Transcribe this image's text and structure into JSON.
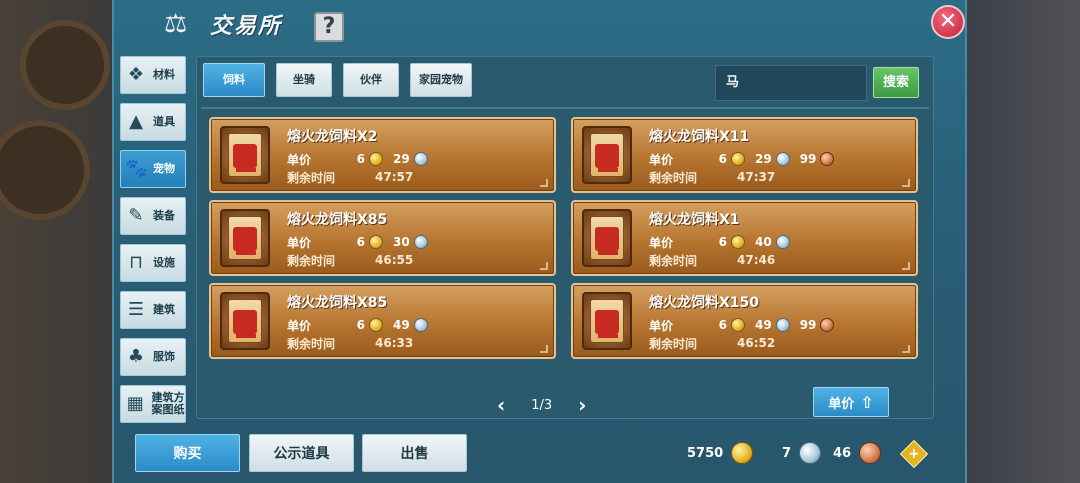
{
  "window": {
    "title": "交易所",
    "help_label": "?",
    "close_label": "✕"
  },
  "sidebar": {
    "items": [
      {
        "label": "材料",
        "icon": "materials-icon"
      },
      {
        "label": "道具",
        "icon": "item-icon"
      },
      {
        "label": "宠物",
        "icon": "paw-icon",
        "active": true
      },
      {
        "label": "装备",
        "icon": "equipment-icon"
      },
      {
        "label": "设施",
        "icon": "facility-icon"
      },
      {
        "label": "建筑",
        "icon": "building-icon"
      },
      {
        "label": "服饰",
        "icon": "clothing-icon"
      },
      {
        "label": "建筑方案图纸",
        "icon": "blueprint-icon"
      }
    ]
  },
  "tabs": [
    {
      "label": "饲料",
      "active": true
    },
    {
      "label": "坐骑"
    },
    {
      "label": "伙伴"
    },
    {
      "label": "家园宠物"
    }
  ],
  "search": {
    "value": "马",
    "button_label": "搜索"
  },
  "listings": [
    {
      "name": "熔火龙饲料X2",
      "price_label": "单价",
      "gold": "6",
      "silver": "29",
      "copper": "",
      "time_label": "剩余时间",
      "time": "47:57"
    },
    {
      "name": "熔火龙饲料X11",
      "price_label": "单价",
      "gold": "6",
      "silver": "29",
      "copper": "99",
      "time_label": "剩余时间",
      "time": "47:37"
    },
    {
      "name": "熔火龙饲料X85",
      "price_label": "单价",
      "gold": "6",
      "silver": "30",
      "copper": "",
      "time_label": "剩余时间",
      "time": "46:55"
    },
    {
      "name": "熔火龙饲料X1",
      "price_label": "单价",
      "gold": "6",
      "silver": "40",
      "copper": "",
      "time_label": "剩余时间",
      "time": "47:46"
    },
    {
      "name": "熔火龙饲料X85",
      "price_label": "单价",
      "gold": "6",
      "silver": "49",
      "copper": "",
      "time_label": "剩余时间",
      "time": "46:33"
    },
    {
      "name": "熔火龙饲料X150",
      "price_label": "单价",
      "gold": "6",
      "silver": "49",
      "copper": "99",
      "time_label": "剩余时间",
      "time": "46:52"
    }
  ],
  "pager": {
    "text": "1/3",
    "prev": "‹",
    "next": "›"
  },
  "sort": {
    "label": "单价"
  },
  "bottom": {
    "buy_label": "购买",
    "public_label": "公示道具",
    "sell_label": "出售"
  },
  "wallet": {
    "gold": "5750",
    "silver": "7",
    "copper": "46",
    "add_label": "+"
  }
}
